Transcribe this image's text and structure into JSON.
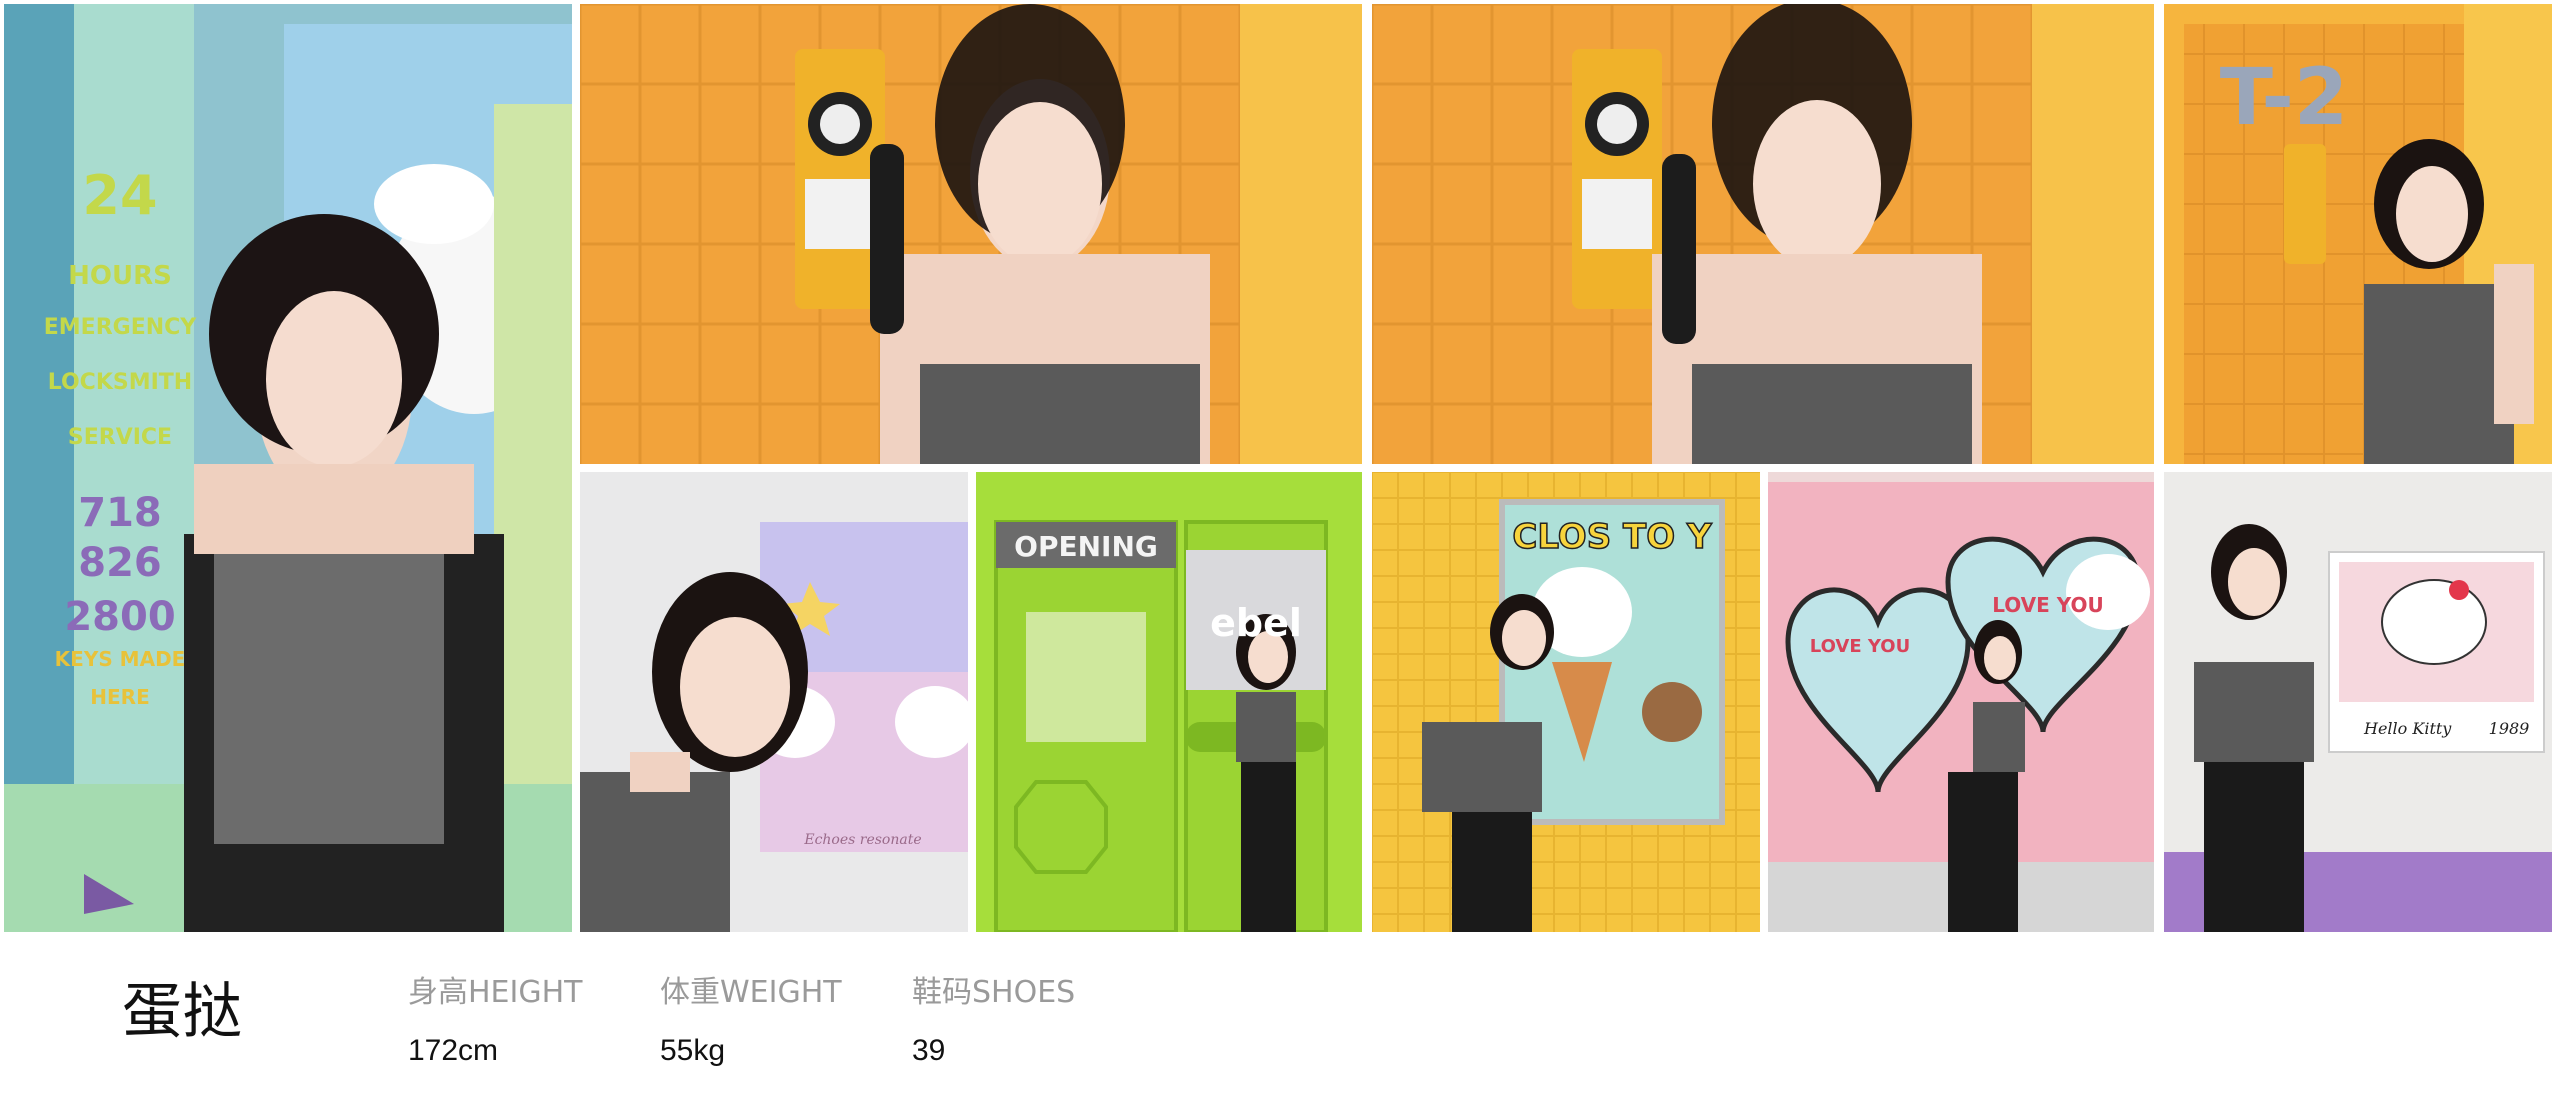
{
  "model": {
    "name": "蛋挞",
    "stats": [
      {
        "label": "身高HEIGHT",
        "value": "172cm"
      },
      {
        "label": "体重WEIGHT",
        "value": "55kg"
      },
      {
        "label": "鞋码SHOES",
        "value": "39"
      }
    ]
  },
  "photos": [
    {
      "name": "photo-locksmith-wall",
      "signage": [
        "24",
        "HOURS",
        "EMERGENCY",
        "LOCKSMITH",
        "SERVICE",
        "718",
        "826",
        "2800",
        "KEYS MADE",
        "HERE"
      ]
    },
    {
      "name": "photo-phone-wink"
    },
    {
      "name": "photo-phone-talk"
    },
    {
      "name": "photo-booth-t2",
      "signage": [
        "T-2"
      ]
    },
    {
      "name": "photo-poster-pose",
      "signage": [
        "Echoes resonate"
      ]
    },
    {
      "name": "photo-green-door",
      "signage": [
        "OPENING",
        "ebel"
      ]
    },
    {
      "name": "photo-yellow-tiles",
      "signage": [
        "CLOS TO Y"
      ]
    },
    {
      "name": "photo-pink-hearts",
      "signage": [
        "LOVE YOU",
        "LOVE YOU"
      ]
    },
    {
      "name": "photo-polaroid-wall",
      "signage": [
        "Hello Kitty",
        "1989"
      ]
    }
  ],
  "colors": {
    "name_text": "#111111",
    "label_text": "#9a9a9a",
    "value_text": "#111111",
    "background": "#ffffff"
  }
}
